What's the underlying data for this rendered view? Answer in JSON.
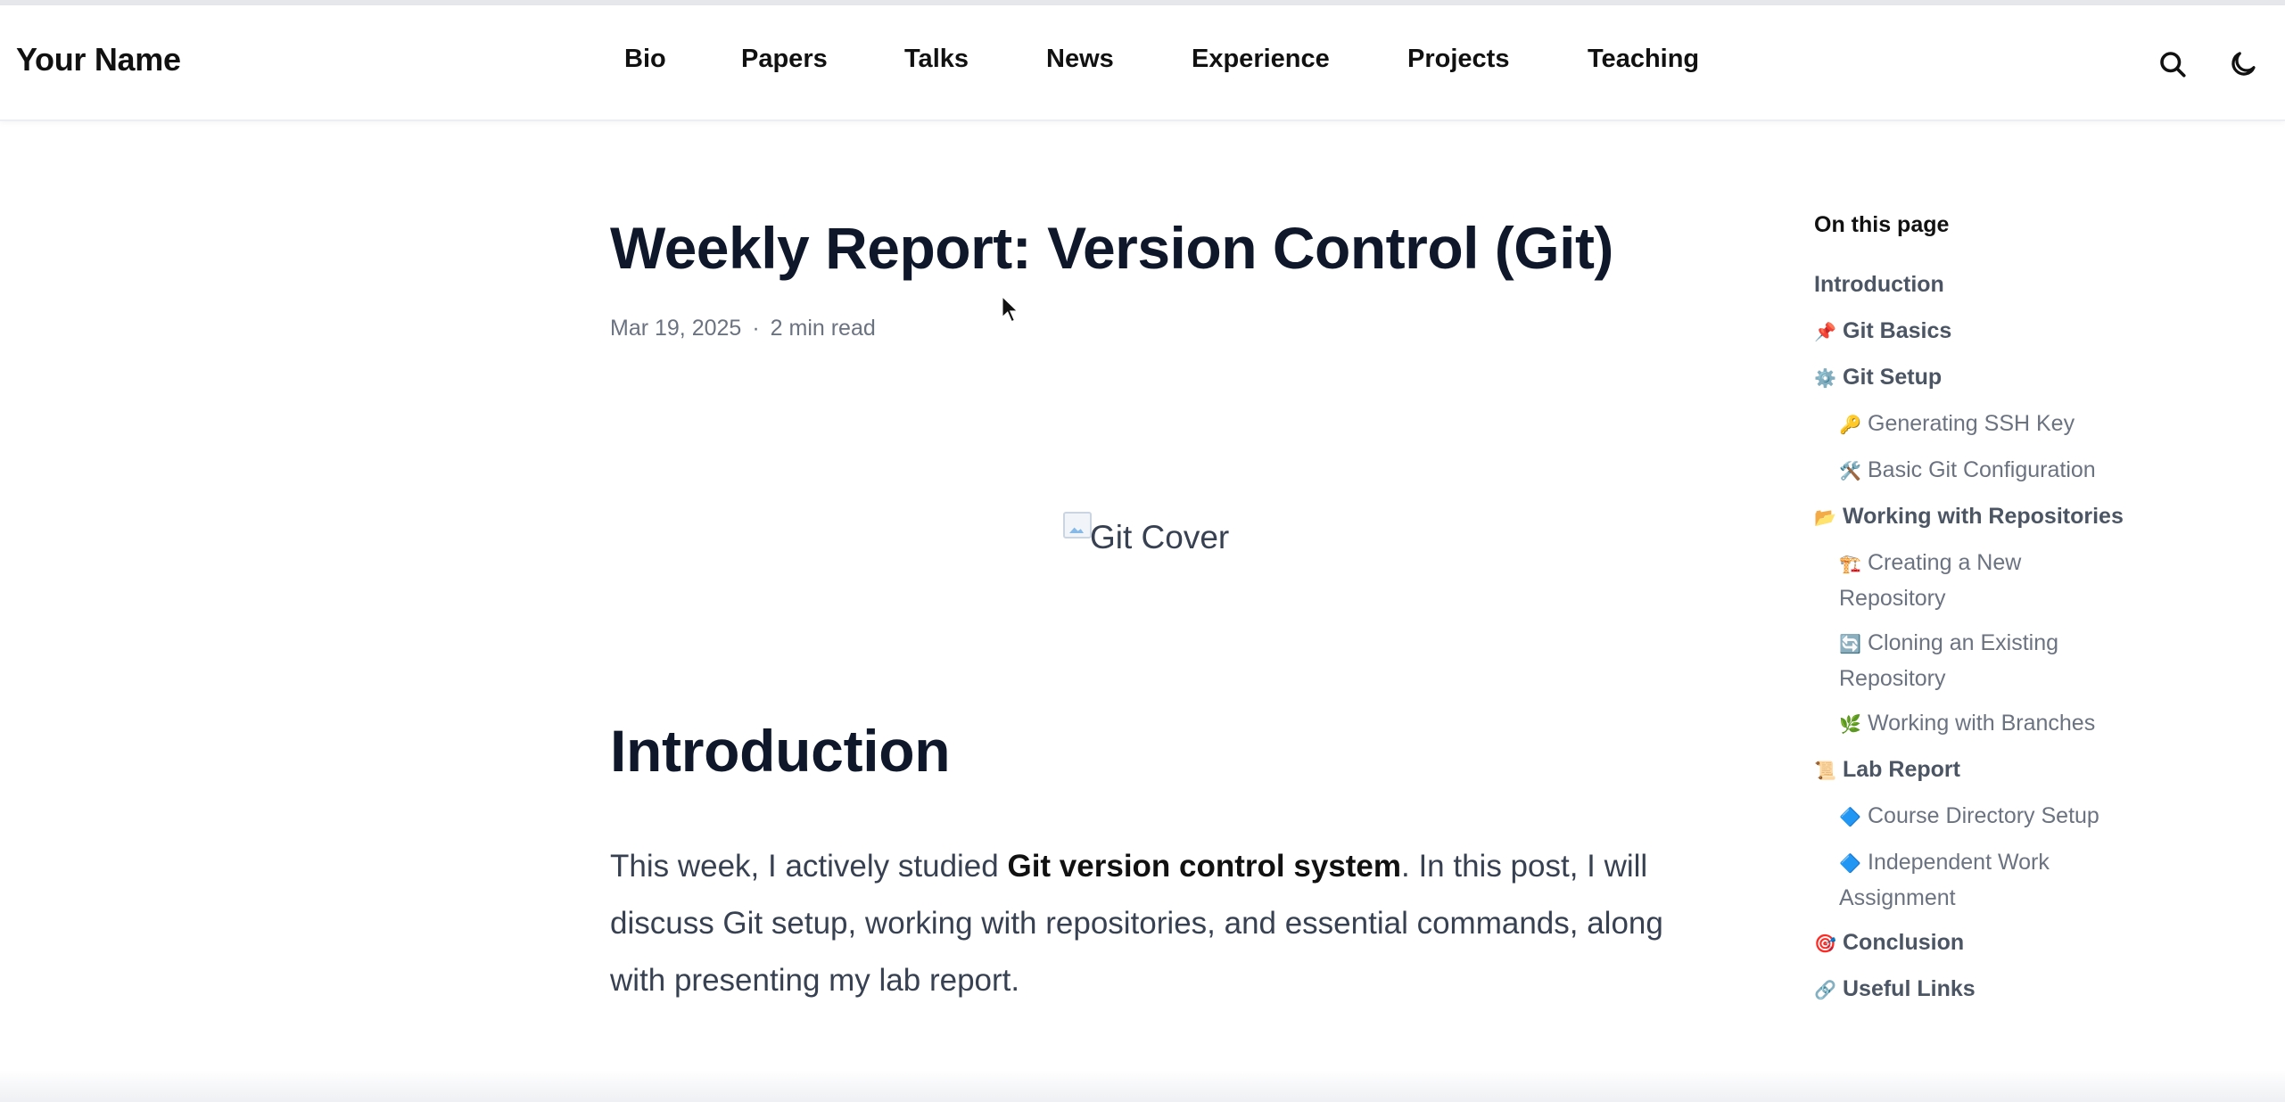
{
  "header": {
    "site_name": "Your Name",
    "nav": [
      "Bio",
      "Papers",
      "Talks",
      "News",
      "Experience",
      "Projects",
      "Teaching"
    ],
    "icons": [
      "search-icon",
      "moon-icon"
    ]
  },
  "article": {
    "title": "Weekly Report: Version Control (Git)",
    "date": "Mar 19, 2025",
    "separator": "·",
    "read_time": "2 min read",
    "cover_alt": "Git Cover",
    "intro_heading": "Introduction",
    "intro_before": "This week, I actively studied ",
    "intro_bold": "Git version control system",
    "intro_after": ". In this post, I will discuss Git setup, working with repositories, and essential commands, along with presenting my lab report."
  },
  "toc": {
    "heading": "On this page",
    "items": [
      {
        "emoji": "",
        "label": "Introduction",
        "level": 1
      },
      {
        "emoji": "📌",
        "label": "Git Basics",
        "level": 1
      },
      {
        "emoji": "⚙️",
        "label": "Git Setup",
        "level": 1
      },
      {
        "emoji": "🔑",
        "label": "Generating SSH Key",
        "level": 2
      },
      {
        "emoji": "🛠️",
        "label": "Basic Git Configuration",
        "level": 2
      },
      {
        "emoji": "📂",
        "label": "Working with Repositories",
        "level": 1
      },
      {
        "emoji": "🏗️",
        "label": "Creating a New Repository",
        "level": 2
      },
      {
        "emoji": "🔄",
        "label": "Cloning an Existing Repository",
        "level": 2
      },
      {
        "emoji": "🌿",
        "label": "Working with Branches",
        "level": 2
      },
      {
        "emoji": "📜",
        "label": "Lab Report",
        "level": 1
      },
      {
        "emoji": "🔷",
        "label": "Course Directory Setup",
        "level": 2
      },
      {
        "emoji": "🔷",
        "label": "Independent Work Assignment",
        "level": 2
      },
      {
        "emoji": "🎯",
        "label": "Conclusion",
        "level": 1
      },
      {
        "emoji": "🔗",
        "label": "Useful Links",
        "level": 1
      }
    ]
  }
}
